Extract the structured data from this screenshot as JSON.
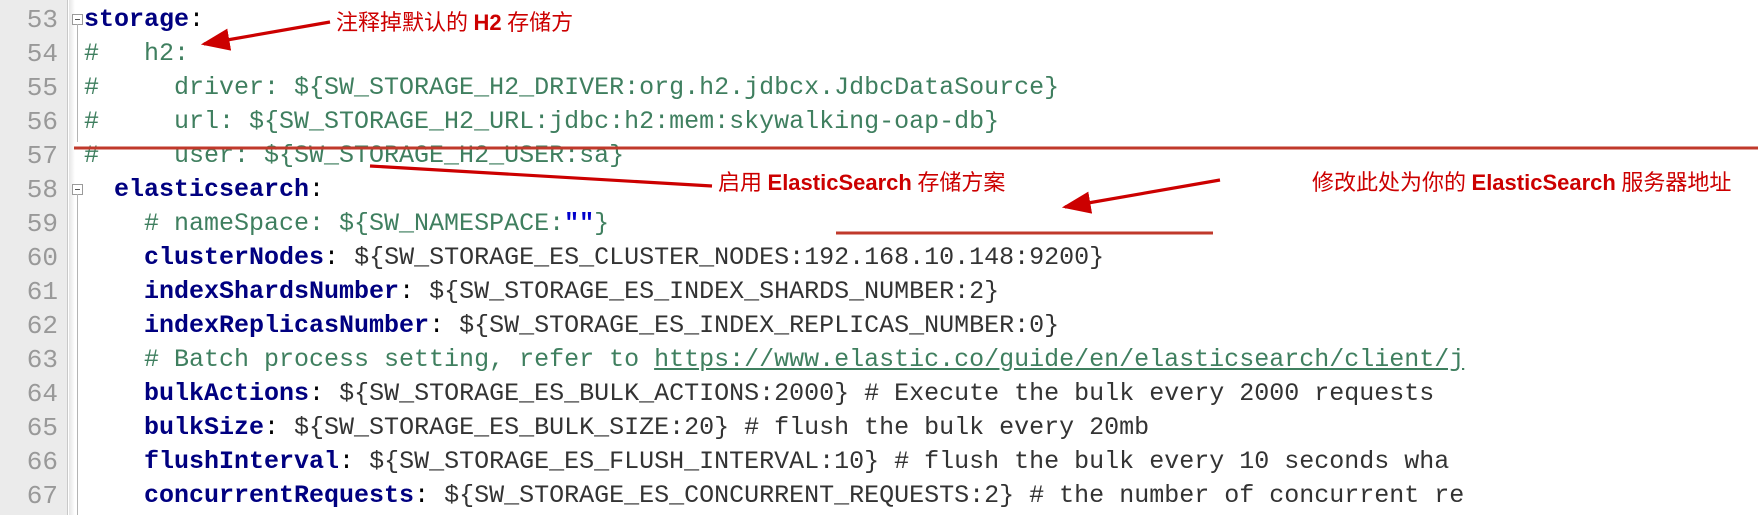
{
  "editor": {
    "language": "yaml",
    "gutter_bg": "#ebebeb",
    "first_line": 53,
    "lines": [
      {
        "num": "53",
        "indent": 0,
        "fold": true,
        "tokens": [
          {
            "t": "storage",
            "c": "k"
          },
          {
            "t": ":",
            "c": "p"
          }
        ]
      },
      {
        "num": "54",
        "indent": 0,
        "fold": false,
        "tokens": [
          {
            "t": "#   h2:",
            "c": "cm"
          }
        ]
      },
      {
        "num": "55",
        "indent": 0,
        "fold": false,
        "tokens": [
          {
            "t": "#     driver: ${SW_STORAGE_H2_DRIVER:org.h2.jdbcx.JdbcDataSource}",
            "c": "cm"
          }
        ]
      },
      {
        "num": "56",
        "indent": 0,
        "fold": false,
        "tokens": [
          {
            "t": "#     url: ${SW_STORAGE_H2_URL:jdbc:h2:mem:skywalking-oap-db}",
            "c": "cm"
          }
        ]
      },
      {
        "num": "57",
        "indent": 0,
        "fold": false,
        "tokens": [
          {
            "t": "#     user: ${SW_STORAGE_H2_USER:sa}",
            "c": "cm"
          }
        ]
      },
      {
        "num": "58",
        "indent": 0,
        "fold": true,
        "tokens": [
          {
            "t": "  elasticsearch",
            "c": "k"
          },
          {
            "t": ":",
            "c": "p"
          }
        ]
      },
      {
        "num": "59",
        "indent": 0,
        "fold": false,
        "tokens": [
          {
            "t": "    # nameSpace: ${SW_NAMESPACE:",
            "c": "cm"
          },
          {
            "t": "\"\"",
            "c": "str"
          },
          {
            "t": "}",
            "c": "cm"
          }
        ]
      },
      {
        "num": "60",
        "indent": 0,
        "fold": false,
        "tokens": [
          {
            "t": "    clusterNodes",
            "c": "k"
          },
          {
            "t": ": ",
            "c": "p"
          },
          {
            "t": "${SW_STORAGE_ES_CLUSTER_NODES:192.168.10.148:9200}",
            "c": "v"
          }
        ]
      },
      {
        "num": "61",
        "indent": 0,
        "fold": false,
        "tokens": [
          {
            "t": "    indexShardsNumber",
            "c": "k"
          },
          {
            "t": ": ",
            "c": "p"
          },
          {
            "t": "${SW_STORAGE_ES_INDEX_SHARDS_NUMBER:2}",
            "c": "v"
          }
        ]
      },
      {
        "num": "62",
        "indent": 0,
        "fold": false,
        "tokens": [
          {
            "t": "    indexReplicasNumber",
            "c": "k"
          },
          {
            "t": ": ",
            "c": "p"
          },
          {
            "t": "${SW_STORAGE_ES_INDEX_REPLICAS_NUMBER:0}",
            "c": "v"
          }
        ]
      },
      {
        "num": "63",
        "indent": 0,
        "fold": false,
        "tokens": [
          {
            "t": "    # Batch process setting, refer to ",
            "c": "cm"
          },
          {
            "t": "https://www.elastic.co/guide/en/elasticsearch/client/j",
            "c": "lnk"
          }
        ]
      },
      {
        "num": "64",
        "indent": 0,
        "fold": false,
        "tokens": [
          {
            "t": "    bulkActions",
            "c": "k"
          },
          {
            "t": ": ",
            "c": "p"
          },
          {
            "t": "${SW_STORAGE_ES_BULK_ACTIONS:2000} # Execute the bulk every 2000 requests",
            "c": "v"
          }
        ]
      },
      {
        "num": "65",
        "indent": 0,
        "fold": false,
        "tokens": [
          {
            "t": "    bulkSize",
            "c": "k"
          },
          {
            "t": ": ",
            "c": "p"
          },
          {
            "t": "${SW_STORAGE_ES_BULK_SIZE:20} # flush the bulk every 20mb",
            "c": "v"
          }
        ]
      },
      {
        "num": "66",
        "indent": 0,
        "fold": false,
        "tokens": [
          {
            "t": "    flushInterval",
            "c": "k"
          },
          {
            "t": ": ",
            "c": "p"
          },
          {
            "t": "${SW_STORAGE_ES_FLUSH_INTERVAL:10} # flush the bulk every 10 seconds wha",
            "c": "v"
          }
        ]
      },
      {
        "num": "67",
        "indent": 0,
        "fold": false,
        "tokens": [
          {
            "t": "    concurrentRequests",
            "c": "k"
          },
          {
            "t": ": ",
            "c": "p"
          },
          {
            "t": "${SW_STORAGE_ES_CONCURRENT_REQUESTS:2} # the number of concurrent re",
            "c": "v"
          }
        ]
      }
    ]
  },
  "annotations": {
    "color": "#cc0000",
    "items": [
      {
        "id": "comment-out-h2",
        "segments": [
          {
            "text": "注释掉默认的 ",
            "bold": false
          },
          {
            "text": "H2",
            "bold": true
          },
          {
            "text": " 存储方",
            "bold": false
          }
        ]
      },
      {
        "id": "enable-elasticsearch",
        "segments": [
          {
            "text": "启用 ",
            "bold": false
          },
          {
            "text": "ElasticSearch",
            "bold": true
          },
          {
            "text": " 存储方案",
            "bold": false
          }
        ]
      },
      {
        "id": "change-es-server-address",
        "segments": [
          {
            "text": "修改此处为你的 ",
            "bold": false
          },
          {
            "text": "ElasticSearch",
            "bold": true
          },
          {
            "text": " 服务器地址",
            "bold": false
          }
        ]
      }
    ]
  }
}
